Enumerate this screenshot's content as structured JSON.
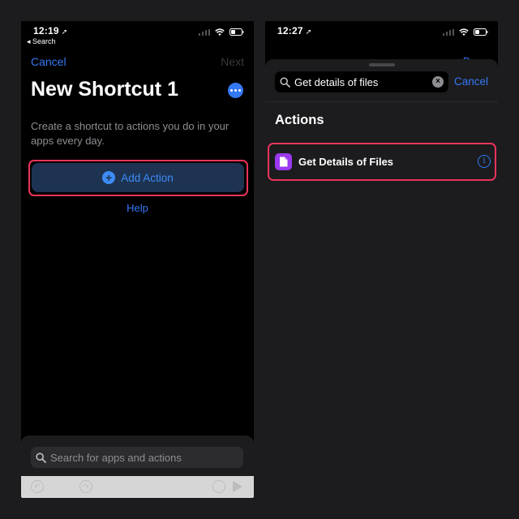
{
  "left": {
    "status": {
      "time": "12:19",
      "back_label": "◂ Search"
    },
    "nav": {
      "cancel": "Cancel",
      "next": "Next"
    },
    "title": "New Shortcut 1",
    "description": "Create a shortcut to actions you do in your apps every day.",
    "add_action_label": "Add Action",
    "help_label": "Help",
    "search_placeholder": "Search for apps and actions"
  },
  "right": {
    "status": {
      "time": "12:27"
    },
    "done_peek": "Done",
    "search": {
      "value": "Get details of files",
      "cancel": "Cancel"
    },
    "section_title": "Actions",
    "result_label": "Get Details of Files"
  },
  "colors": {
    "accent": "#3478f6",
    "highlight": "#e8345a",
    "file_icon": "#9b3af0",
    "background": "#1c1c1e"
  },
  "icons": [
    "location-arrow-icon",
    "signal-icon",
    "wifi-icon",
    "battery-icon",
    "more-icon",
    "plus-icon",
    "search-icon",
    "clear-icon",
    "file-icon",
    "info-icon",
    "play-icon"
  ]
}
